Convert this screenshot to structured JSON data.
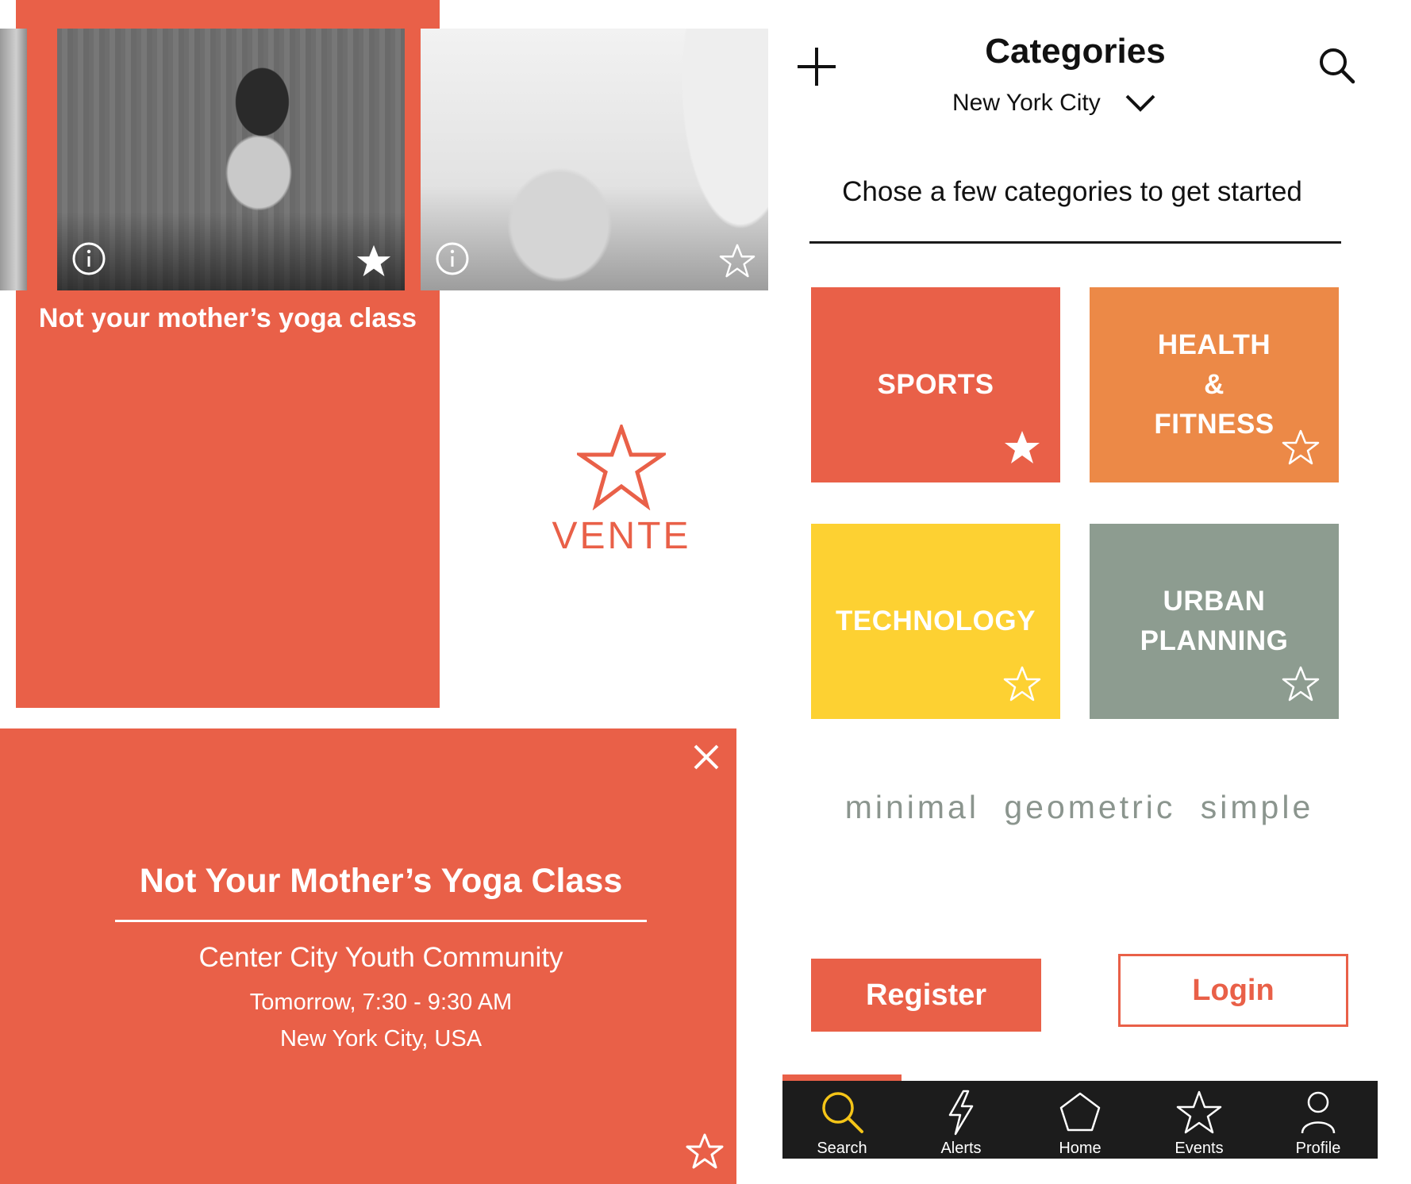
{
  "colors": {
    "coral": "#E96048",
    "orange": "#EC8947",
    "yellow": "#FDD132",
    "sage": "#8D9C90",
    "tagline": "#8B958E",
    "tabbar": "#1C1C1C",
    "active_tab_icon": "#F5C518"
  },
  "card": {
    "title": "Not your mother’s yoga class",
    "photos": [
      {
        "name": "partial-photo",
        "favorited": false
      },
      {
        "name": "yoga-photo",
        "info_icon": "info-icon",
        "favorited": true
      },
      {
        "name": "water-photo",
        "info_icon": "info-icon",
        "favorited": false
      }
    ]
  },
  "logo": {
    "wordmark": "VENTE",
    "icon": "star-outline-logo-icon"
  },
  "detail": {
    "title": "Not Your Mother’s Yoga Class",
    "organizer": "Center City Youth Community",
    "time": "Tomorrow, 7:30 - 9:30 AM",
    "location": "New York City, USA",
    "close_icon": "close-icon",
    "favorite_icon": "star-outline-icon"
  },
  "categories_screen": {
    "title": "Categories",
    "city": "New York City",
    "prompt": "Chose a few categories to get started",
    "tiles": [
      {
        "label": "SPORTS",
        "selected": true
      },
      {
        "label": "HEALTH\n&\nFITNESS",
        "selected": false
      },
      {
        "label": "TECHNOLOGY",
        "selected": false
      },
      {
        "label": "URBAN\nPLANNING",
        "selected": false
      }
    ],
    "tagline": "minimal geometric simple",
    "register_label": "Register",
    "login_label": "Login"
  },
  "tabs": [
    {
      "label": "Search",
      "icon": "search-icon",
      "active": true
    },
    {
      "label": "Alerts",
      "icon": "lightning-icon",
      "active": false
    },
    {
      "label": "Home",
      "icon": "pentagon-home-icon",
      "active": false
    },
    {
      "label": "Events",
      "icon": "star-icon",
      "active": false
    },
    {
      "label": "Profile",
      "icon": "person-icon",
      "active": false
    }
  ]
}
